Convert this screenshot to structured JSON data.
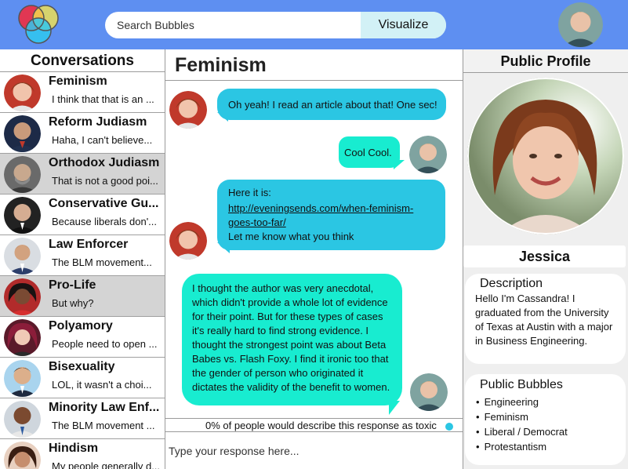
{
  "header": {
    "search_placeholder": "Search Bubbles",
    "visualize_label": "Visualize"
  },
  "conversations": {
    "title": "Conversations",
    "items": [
      {
        "name": "Feminism",
        "preview": "I think that that is an ...",
        "selected": false
      },
      {
        "name": "Reform Judiasm",
        "preview": "Haha, I can't believe...",
        "selected": false
      },
      {
        "name": "Orthodox Judiasm",
        "preview": "That is not a good poi...",
        "selected": true
      },
      {
        "name": "Conservative Gu...",
        "preview": "Because liberals don'...",
        "selected": false
      },
      {
        "name": "Law Enforcer",
        "preview": "The BLM movement...",
        "selected": false
      },
      {
        "name": "Pro-Life",
        "preview": "But why?",
        "selected": true
      },
      {
        "name": "Polyamory",
        "preview": "People need to open ...",
        "selected": false
      },
      {
        "name": "Bisexuality",
        "preview": "LOL, it wasn't a choi...",
        "selected": false
      },
      {
        "name": "Minority Law Enf...",
        "preview": "The BLM movement ...",
        "selected": false
      },
      {
        "name": "Hindism",
        "preview": "My people generally d...",
        "selected": false
      }
    ]
  },
  "chat": {
    "title": "Feminism",
    "messages": [
      {
        "text": "Oh yeah! I read an article about that! One sec!"
      },
      {
        "text": "Cool Cool."
      },
      {
        "line1": "Here it is:",
        "link": "http://eveningsends.com/when-feminism-goes-too-far/",
        "link_line1": "http://eveningsends.com/when-feminism-",
        "link_line2": "goes-too-far/",
        "line3": "Let me know what you think"
      },
      {
        "text": "I thought the author was very anecdotal, which didn't provide a whole lot of evidence for their point. But for these types of cases it's really hard to find strong evidence. I thought the strongest point was about Beta Babes vs. Flash Foxy. I find it ironic too that the gender of person who originated it dictates the validity of the benefit to women."
      }
    ],
    "toxicity_text": "0% of people would describe this response as toxic",
    "reply_placeholder": "Type your response here..."
  },
  "profile": {
    "title": "Public Profile",
    "name": "Jessica",
    "description_title": "Description",
    "description": "Hello I'm Cassandra! I graduated from the University of Texas at Austin with a major in Business Engineering.",
    "bubbles_title": "Public Bubbles",
    "bubbles": [
      "Engineering",
      "Feminism",
      "Liberal / Democrat",
      "Protestantism"
    ]
  },
  "colors": {
    "header": "#5e8ff1",
    "bubble_blue": "#2bc6e3",
    "bubble_green": "#18ecd0",
    "selected_row": "#d4d4d4"
  }
}
